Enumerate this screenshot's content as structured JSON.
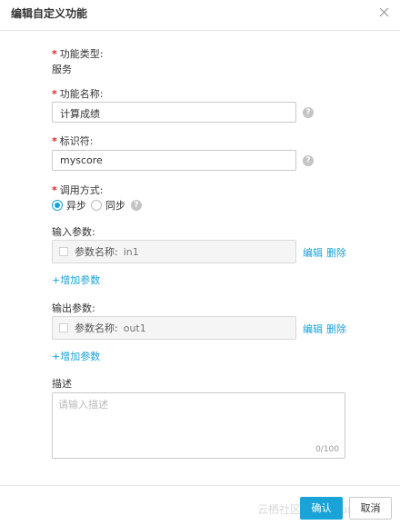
{
  "dialog": {
    "title": "编辑自定义功能"
  },
  "form": {
    "function_type": {
      "label": "功能类型:",
      "value": "服务"
    },
    "function_name": {
      "label": "功能名称:",
      "value": "计算成绩"
    },
    "identifier": {
      "label": "标识符:",
      "value": "myscore"
    },
    "call_mode": {
      "label": "调用方式:",
      "options": [
        "异步",
        "同步"
      ],
      "selected": "异步"
    },
    "input_params": {
      "label": "输入参数:",
      "item_label": "参数名称:",
      "item_value": "in1",
      "edit": "编辑",
      "delete": "删除",
      "add": "+增加参数"
    },
    "output_params": {
      "label": "输出参数:",
      "item_label": "参数名称:",
      "item_value": "out1",
      "edit": "编辑",
      "delete": "删除",
      "add": "+增加参数"
    },
    "description": {
      "label": "描述",
      "placeholder": "请输入描述",
      "counter": "0/100"
    }
  },
  "footer": {
    "confirm": "确认",
    "cancel": "取消",
    "watermark": "云栖社区 yq.aliyun.com"
  },
  "colors": {
    "accent": "#1aa3d6",
    "required": "#e02020",
    "border": "#c9c9c9"
  }
}
